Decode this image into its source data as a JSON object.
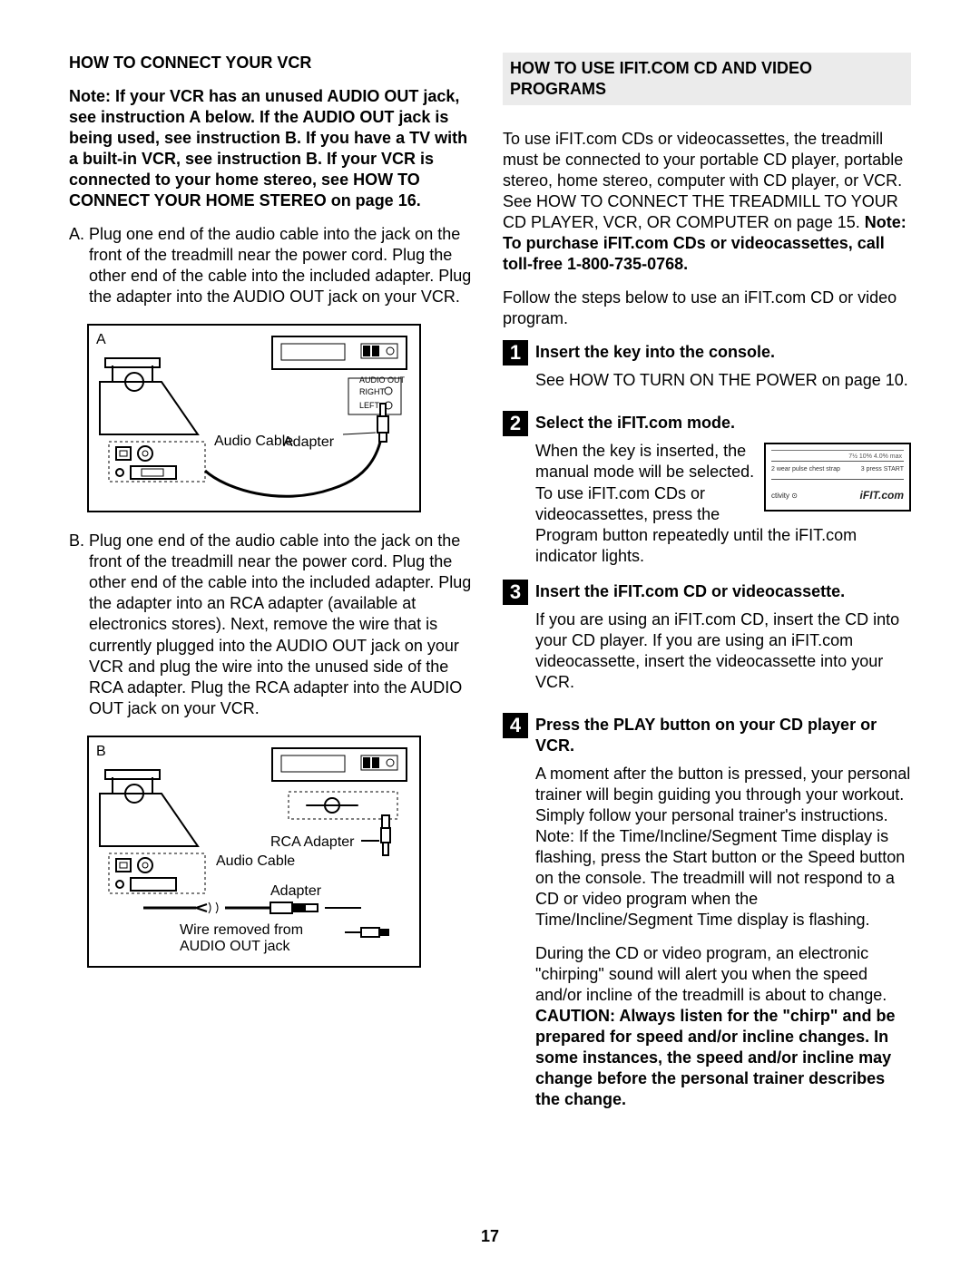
{
  "left": {
    "heading": "HOW TO CONNECT YOUR VCR",
    "note": "Note: If your VCR has an unused AUDIO OUT jack, see instruction A below. If the AUDIO OUT jack is being used, see instruction B. If you have a TV with a built-in VCR, see instruction B. If your VCR is connected to your home stereo, see HOW TO CONNECT YOUR HOME STEREO on page 16.",
    "a_tag": "A.",
    "a_text": "Plug one end of the audio cable into the jack on the front of the treadmill near the power cord. Plug the other end of the cable into the included adapter. Plug the adapter into the AUDIO OUT jack on your VCR.",
    "diagA": {
      "letter": "A",
      "audio_cable": "Audio Cable",
      "adapter": "Adapter",
      "audio_out": "AUDIO OUT",
      "right": "RIGHT",
      "left": "LEFT"
    },
    "b_tag": "B.",
    "b_text": "Plug one end of the audio cable into the jack on the front of the treadmill near the power cord. Plug the other end of the cable into the included adapter. Plug the adapter into an RCA adapter (available at electronics stores). Next, remove the wire that is currently plugged into the AUDIO OUT jack on your VCR and plug the wire into the unused side of the RCA adapter. Plug the RCA adapter into the AUDIO OUT jack on your VCR.",
    "diagB": {
      "letter": "B",
      "audio_cable": "Audio Cable",
      "adapter": "Adapter",
      "rca_adapter": "RCA Adapter",
      "wire_removed": "Wire removed from AUDIO OUT jack"
    }
  },
  "right": {
    "heading": "HOW TO USE IFIT.COM CD AND VIDEO PROGRAMS",
    "p1_a": "To use iFIT.com CDs or videocassettes, the treadmill must be connected to your portable CD player, portable stereo, home stereo, computer with CD player, or VCR. See HOW TO CONNECT THE TREADMILL TO YOUR CD PLAYER, VCR, OR COMPUTER on page 15. ",
    "p1_b": "Note: To purchase iFIT.com CDs or videocassettes, call toll-free 1-800-735-0768.",
    "p2": "Follow the steps below to use an iFIT.com CD or video program.",
    "steps": {
      "s1": {
        "n": "1",
        "title": "Insert the key into the console.",
        "body": "See HOW TO TURN ON THE POWER on page 10."
      },
      "s2": {
        "n": "2",
        "title": "Select the iFIT.com mode.",
        "body1": "When the key is inserted, the manual mode will be selected. To use iFIT.com CDs or videocassettes, press the Program button re",
        "body2": "peatedly until the iFIT.com indicator lights.",
        "inset": {
          "seg": "7½   10%   4.0% max",
          "row2_left": "2  wear pulse chest strap",
          "row2_right": "3  press START",
          "row3_left": "ctivity  ⊙",
          "row3_ifit": "iFIT.com"
        }
      },
      "s3": {
        "n": "3",
        "title": "Insert the iFIT.com CD or videocassette.",
        "body": "If you are using an iFIT.com CD, insert the CD into your CD player. If you are using an iFIT.com videocassette, insert the videocassette into your VCR."
      },
      "s4": {
        "n": "4",
        "title": "Press the PLAY button on your CD player or VCR.",
        "body1": "A moment after the button is pressed, your personal trainer will begin guiding you through your workout. Simply follow your personal trainer's instructions. Note: If the Time/Incline/Segment Time display is flashing, press the Start button or the Speed    button on the console. The treadmill will not respond to a CD or video program when the Time/Incline/Segment Time display is flashing.",
        "body2a": "During the CD or video program, an electronic \"chirping\" sound will alert you when the speed and/or incline of the treadmill is about to change. ",
        "body2b": "CAUTION: Always listen for the \"chirp\" and be prepared for speed and/or incline changes. In some instances, the speed and/or incline may change before the personal trainer describes the change."
      }
    }
  },
  "page_number": "17"
}
